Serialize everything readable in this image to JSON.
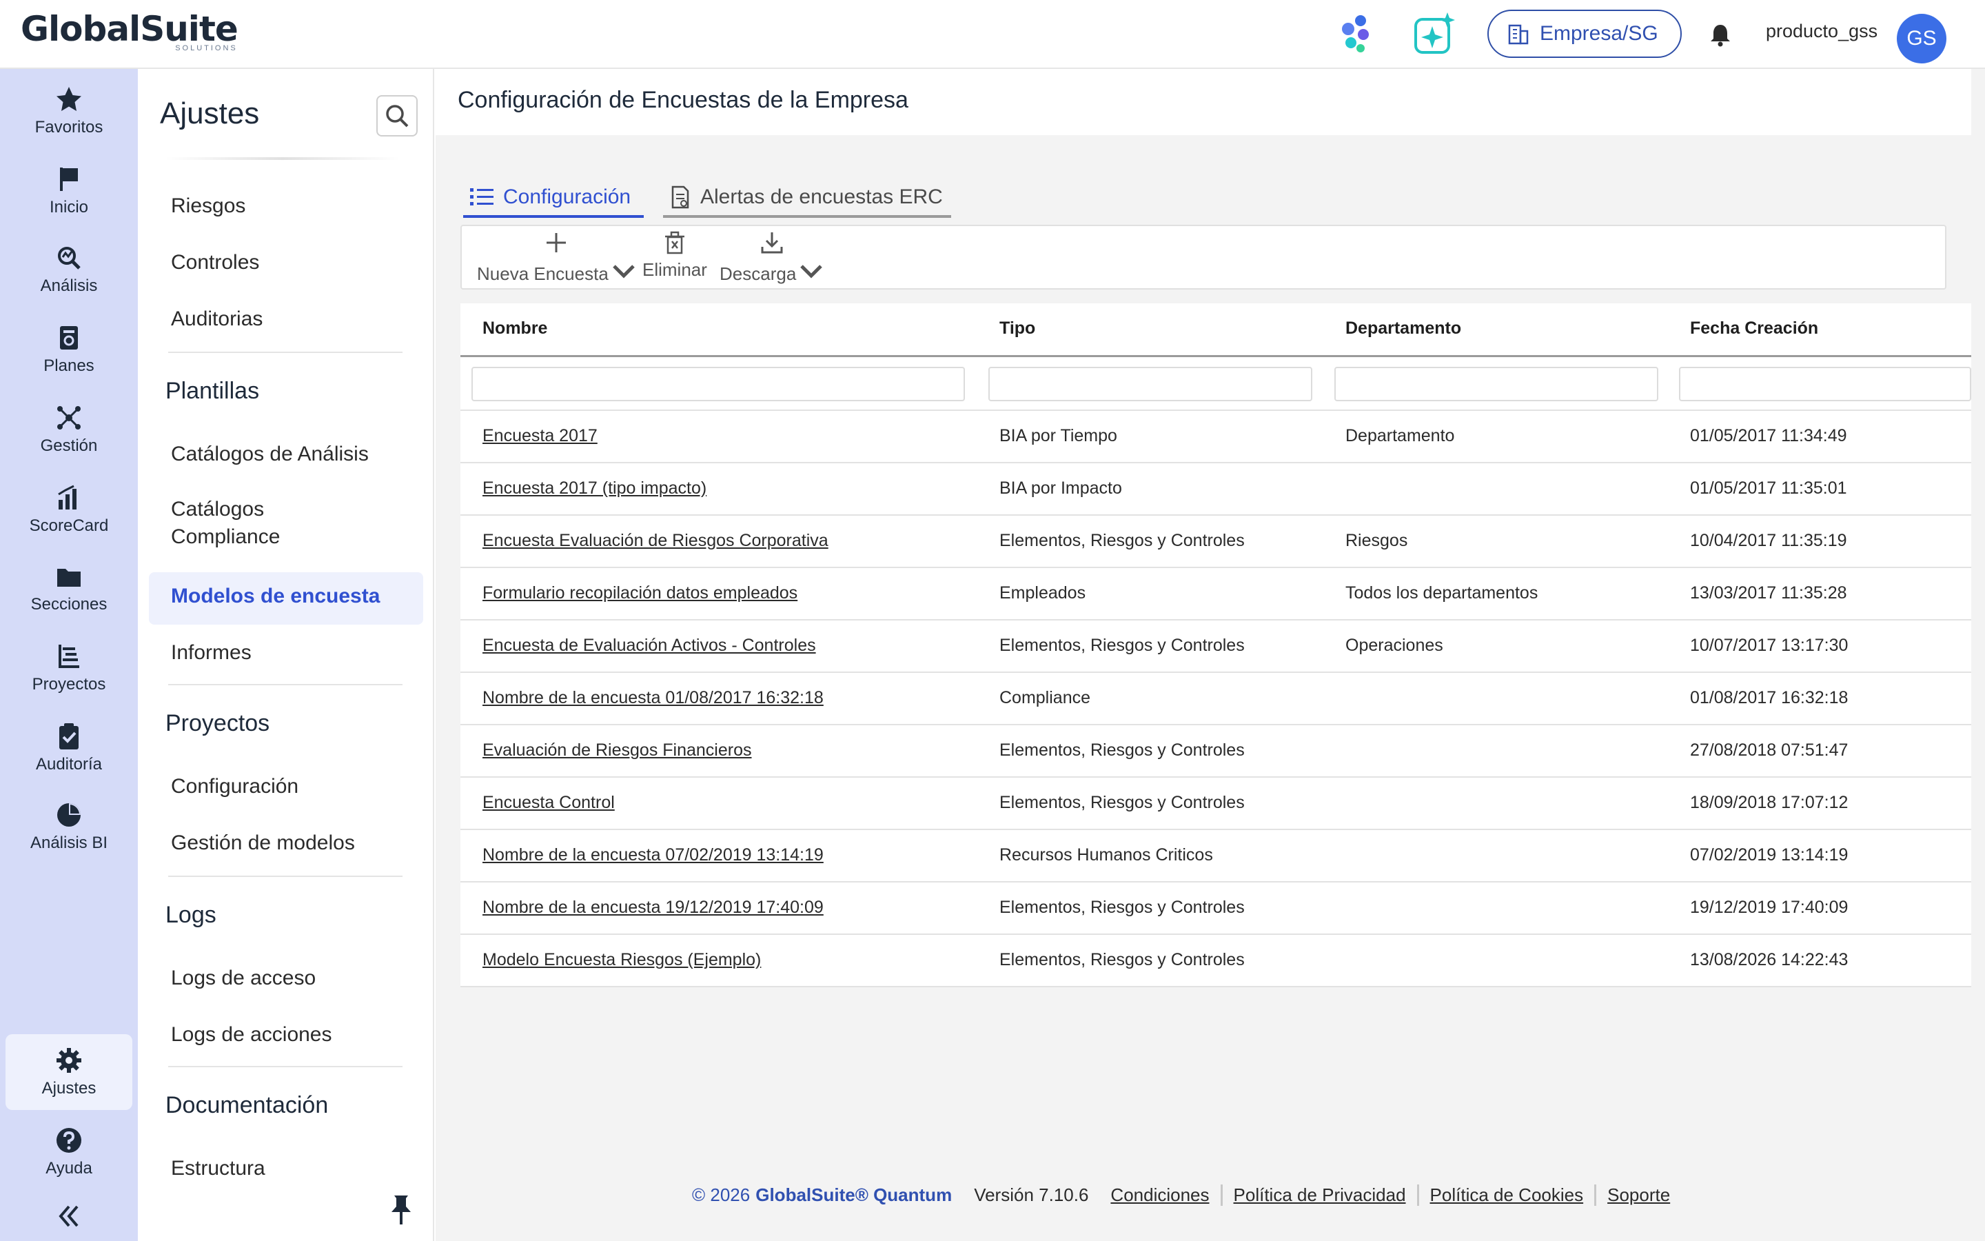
{
  "header": {
    "logo_text": "GlobalSuite",
    "logo_sub": "SOLUTIONS",
    "company_button": "Empresa/SG",
    "username": "producto_gss",
    "avatar_initials": "GS",
    "accent_color": "#3050b0"
  },
  "rail": {
    "items": [
      {
        "label": "Favoritos",
        "icon": "star-icon"
      },
      {
        "label": "Inicio",
        "icon": "flag-icon"
      },
      {
        "label": "Análisis",
        "icon": "analysis-icon"
      },
      {
        "label": "Planes",
        "icon": "plans-icon"
      },
      {
        "label": "Gestión",
        "icon": "management-icon"
      },
      {
        "label": "ScoreCard",
        "icon": "chart-bars-icon"
      },
      {
        "label": "Secciones",
        "icon": "folder-icon"
      },
      {
        "label": "Proyectos",
        "icon": "projects-icon"
      },
      {
        "label": "Auditoría",
        "icon": "clipboard-check-icon"
      },
      {
        "label": "Análisis BI",
        "icon": "pie-chart-icon"
      }
    ],
    "settings": "Ajustes",
    "help": "Ayuda"
  },
  "nav": {
    "title": "Ajustes",
    "items_top": [
      "Riesgos",
      "Controles",
      "Auditorias"
    ],
    "sec_plantillas": "Plantillas",
    "plantillas_items": [
      "Catálogos de Análisis",
      "Catálogos",
      "Compliance",
      "Modelos de encuesta",
      "Informes"
    ],
    "sec_proyectos": "Proyectos",
    "proyectos_items": [
      "Configuración",
      "Gestión de modelos"
    ],
    "sec_logs": "Logs",
    "logs_items": [
      "Logs de acceso",
      "Logs de acciones"
    ],
    "sec_doc": "Documentación",
    "doc_items": [
      "Estructura"
    ]
  },
  "page": {
    "title": "Configuración de Encuestas de la Empresa",
    "tabs": [
      "Configuración",
      "Alertas de encuestas ERC"
    ],
    "toolbar": {
      "new": "Nueva Encuesta",
      "delete": "Eliminar",
      "download": "Descarga"
    }
  },
  "table": {
    "columns": [
      "Nombre",
      "Tipo",
      "Departamento",
      "Fecha Creación"
    ],
    "rows": [
      [
        "Encuesta 2017",
        "BIA por Tiempo",
        "Departamento",
        "01/05/2017 11:34:49"
      ],
      [
        "Encuesta 2017 (tipo impacto)",
        "BIA por Impacto",
        "",
        "01/05/2017 11:35:01"
      ],
      [
        "Encuesta Evaluación de Riesgos Corporativa",
        "Elementos, Riesgos y Controles",
        "Riesgos",
        "10/04/2017 11:35:19"
      ],
      [
        "Formulario recopilación datos empleados",
        "Empleados",
        "Todos los departamentos",
        "13/03/2017 11:35:28"
      ],
      [
        "Encuesta de Evaluación Activos - Controles",
        "Elementos, Riesgos y Controles",
        "Operaciones",
        "10/07/2017 13:17:30"
      ],
      [
        "Nombre de la encuesta 01/08/2017 16:32:18",
        "Compliance",
        "",
        "01/08/2017 16:32:18"
      ],
      [
        "Evaluación de Riesgos Financieros",
        "Elementos, Riesgos y Controles",
        "",
        "27/08/2018 07:51:47"
      ],
      [
        "Encuesta Control",
        "Elementos, Riesgos y Controles",
        "",
        "18/09/2018 17:07:12"
      ],
      [
        "Nombre de la encuesta 07/02/2019 13:14:19",
        "Recursos Humanos Criticos",
        "",
        "07/02/2019 13:14:19"
      ],
      [
        "Nombre de la encuesta 19/12/2019 17:40:09",
        "Elementos, Riesgos y Controles",
        "",
        "19/12/2019 17:40:09"
      ],
      [
        "Modelo Encuesta Riesgos (Ejemplo)",
        "Elementos, Riesgos y Controles",
        "",
        "13/08/2026 14:22:43"
      ]
    ]
  },
  "footer": {
    "copyright": "© 2026",
    "brand": "GlobalSuite® Quantum",
    "version": "Versión 7.10.6",
    "links": [
      "Condiciones",
      "Política de Privacidad",
      "Política de Cookies",
      "Soporte"
    ]
  }
}
